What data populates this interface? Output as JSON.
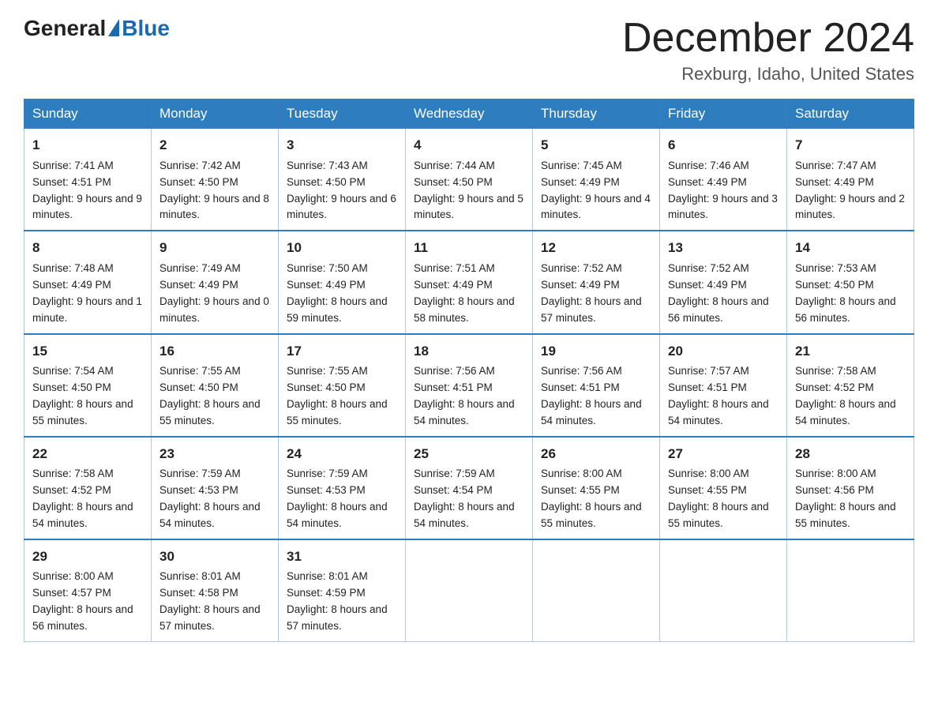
{
  "logo": {
    "general": "General",
    "blue": "Blue"
  },
  "header": {
    "month_year": "December 2024",
    "location": "Rexburg, Idaho, United States"
  },
  "days_of_week": [
    "Sunday",
    "Monday",
    "Tuesday",
    "Wednesday",
    "Thursday",
    "Friday",
    "Saturday"
  ],
  "weeks": [
    [
      {
        "day": "1",
        "sunrise": "7:41 AM",
        "sunset": "4:51 PM",
        "daylight": "9 hours and 9 minutes."
      },
      {
        "day": "2",
        "sunrise": "7:42 AM",
        "sunset": "4:50 PM",
        "daylight": "9 hours and 8 minutes."
      },
      {
        "day": "3",
        "sunrise": "7:43 AM",
        "sunset": "4:50 PM",
        "daylight": "9 hours and 6 minutes."
      },
      {
        "day": "4",
        "sunrise": "7:44 AM",
        "sunset": "4:50 PM",
        "daylight": "9 hours and 5 minutes."
      },
      {
        "day": "5",
        "sunrise": "7:45 AM",
        "sunset": "4:49 PM",
        "daylight": "9 hours and 4 minutes."
      },
      {
        "day": "6",
        "sunrise": "7:46 AM",
        "sunset": "4:49 PM",
        "daylight": "9 hours and 3 minutes."
      },
      {
        "day": "7",
        "sunrise": "7:47 AM",
        "sunset": "4:49 PM",
        "daylight": "9 hours and 2 minutes."
      }
    ],
    [
      {
        "day": "8",
        "sunrise": "7:48 AM",
        "sunset": "4:49 PM",
        "daylight": "9 hours and 1 minute."
      },
      {
        "day": "9",
        "sunrise": "7:49 AM",
        "sunset": "4:49 PM",
        "daylight": "9 hours and 0 minutes."
      },
      {
        "day": "10",
        "sunrise": "7:50 AM",
        "sunset": "4:49 PM",
        "daylight": "8 hours and 59 minutes."
      },
      {
        "day": "11",
        "sunrise": "7:51 AM",
        "sunset": "4:49 PM",
        "daylight": "8 hours and 58 minutes."
      },
      {
        "day": "12",
        "sunrise": "7:52 AM",
        "sunset": "4:49 PM",
        "daylight": "8 hours and 57 minutes."
      },
      {
        "day": "13",
        "sunrise": "7:52 AM",
        "sunset": "4:49 PM",
        "daylight": "8 hours and 56 minutes."
      },
      {
        "day": "14",
        "sunrise": "7:53 AM",
        "sunset": "4:50 PM",
        "daylight": "8 hours and 56 minutes."
      }
    ],
    [
      {
        "day": "15",
        "sunrise": "7:54 AM",
        "sunset": "4:50 PM",
        "daylight": "8 hours and 55 minutes."
      },
      {
        "day": "16",
        "sunrise": "7:55 AM",
        "sunset": "4:50 PM",
        "daylight": "8 hours and 55 minutes."
      },
      {
        "day": "17",
        "sunrise": "7:55 AM",
        "sunset": "4:50 PM",
        "daylight": "8 hours and 55 minutes."
      },
      {
        "day": "18",
        "sunrise": "7:56 AM",
        "sunset": "4:51 PM",
        "daylight": "8 hours and 54 minutes."
      },
      {
        "day": "19",
        "sunrise": "7:56 AM",
        "sunset": "4:51 PM",
        "daylight": "8 hours and 54 minutes."
      },
      {
        "day": "20",
        "sunrise": "7:57 AM",
        "sunset": "4:51 PM",
        "daylight": "8 hours and 54 minutes."
      },
      {
        "day": "21",
        "sunrise": "7:58 AM",
        "sunset": "4:52 PM",
        "daylight": "8 hours and 54 minutes."
      }
    ],
    [
      {
        "day": "22",
        "sunrise": "7:58 AM",
        "sunset": "4:52 PM",
        "daylight": "8 hours and 54 minutes."
      },
      {
        "day": "23",
        "sunrise": "7:59 AM",
        "sunset": "4:53 PM",
        "daylight": "8 hours and 54 minutes."
      },
      {
        "day": "24",
        "sunrise": "7:59 AM",
        "sunset": "4:53 PM",
        "daylight": "8 hours and 54 minutes."
      },
      {
        "day": "25",
        "sunrise": "7:59 AM",
        "sunset": "4:54 PM",
        "daylight": "8 hours and 54 minutes."
      },
      {
        "day": "26",
        "sunrise": "8:00 AM",
        "sunset": "4:55 PM",
        "daylight": "8 hours and 55 minutes."
      },
      {
        "day": "27",
        "sunrise": "8:00 AM",
        "sunset": "4:55 PM",
        "daylight": "8 hours and 55 minutes."
      },
      {
        "day": "28",
        "sunrise": "8:00 AM",
        "sunset": "4:56 PM",
        "daylight": "8 hours and 55 minutes."
      }
    ],
    [
      {
        "day": "29",
        "sunrise": "8:00 AM",
        "sunset": "4:57 PM",
        "daylight": "8 hours and 56 minutes."
      },
      {
        "day": "30",
        "sunrise": "8:01 AM",
        "sunset": "4:58 PM",
        "daylight": "8 hours and 57 minutes."
      },
      {
        "day": "31",
        "sunrise": "8:01 AM",
        "sunset": "4:59 PM",
        "daylight": "8 hours and 57 minutes."
      },
      null,
      null,
      null,
      null
    ]
  ]
}
